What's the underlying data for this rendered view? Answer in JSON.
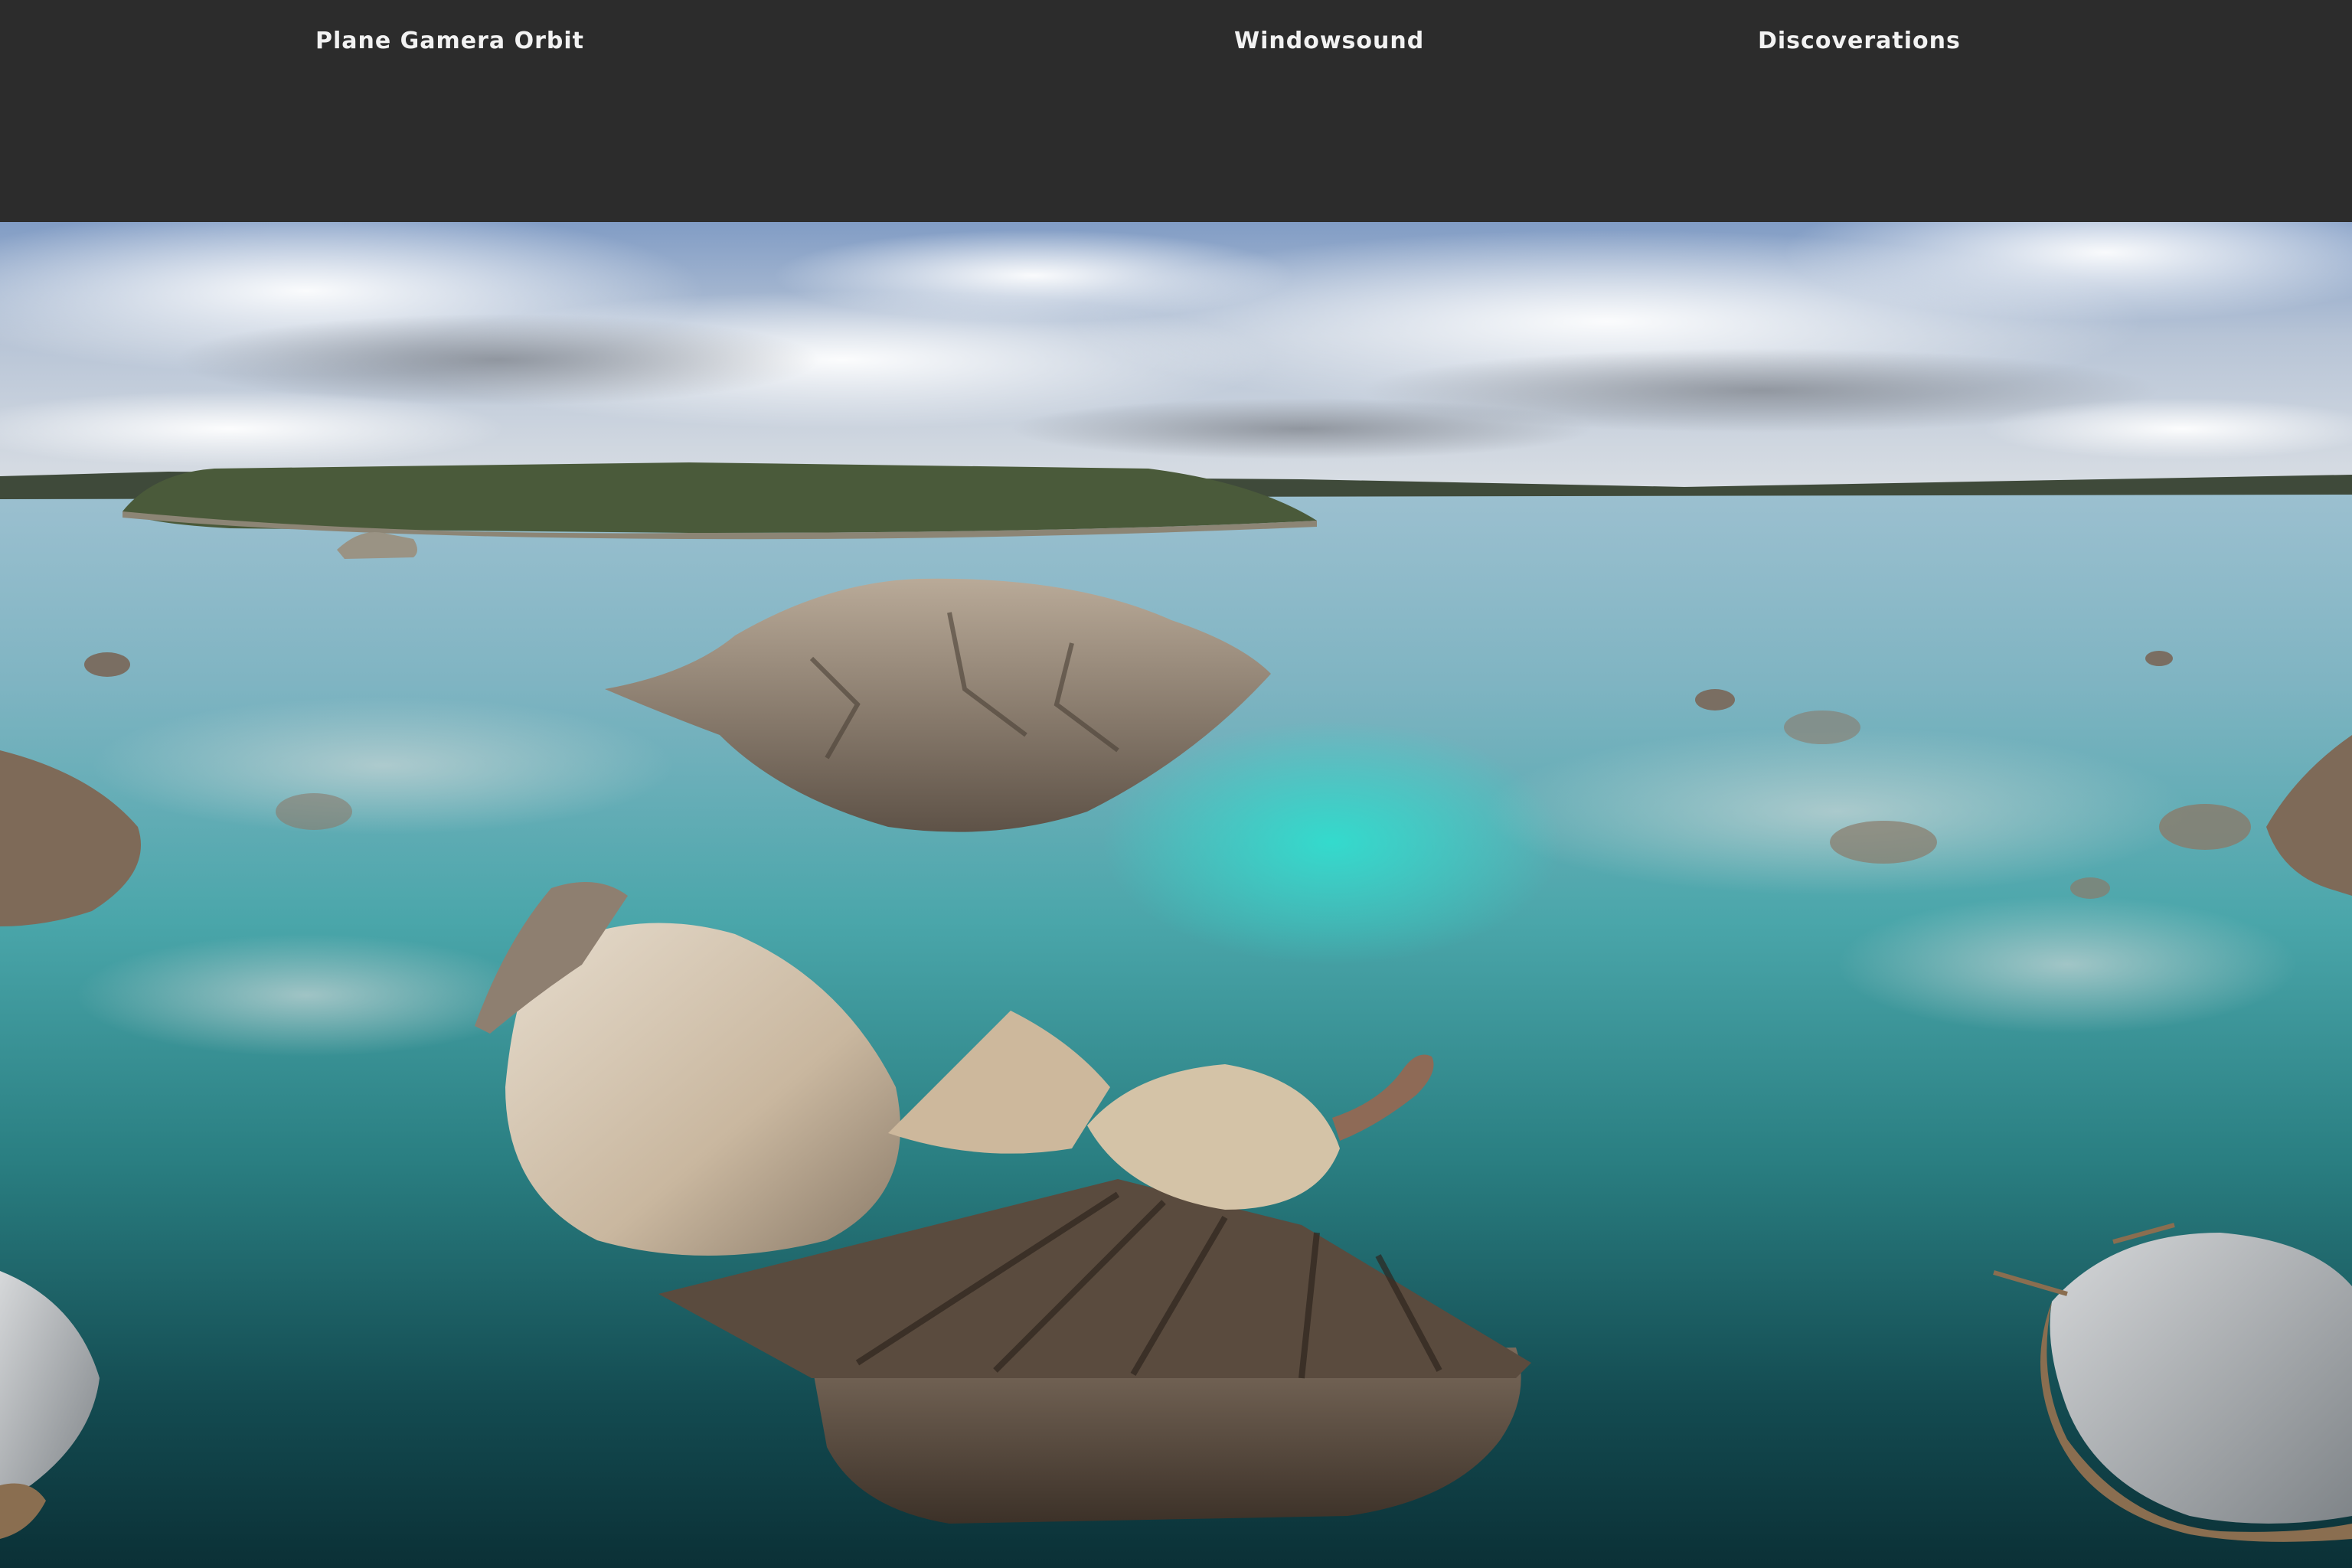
{
  "header": {
    "left_label": "Plane Gamera Orbit",
    "center_label": "Windowsound",
    "right_label": "Discoverations"
  },
  "colors": {
    "bar": "#2c2c2c",
    "sky": "#8fa8c8",
    "water_far": "#8fb7c9",
    "water_mid": "#4fb3b0",
    "water_near": "#0f3f44",
    "rock": "#8b7a6a"
  }
}
